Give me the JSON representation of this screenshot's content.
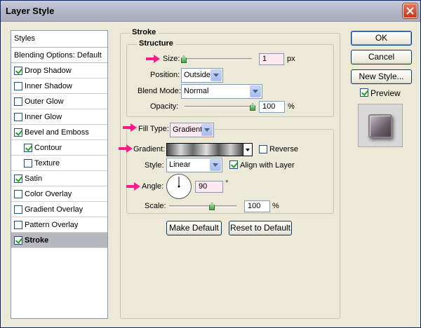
{
  "window": {
    "title": "Layer Style"
  },
  "styles_list": {
    "header": "Styles",
    "items": [
      {
        "label": "Blending Options: Default",
        "checkbox": false,
        "checked": false,
        "indent": false,
        "selected": false
      },
      {
        "label": "Drop Shadow",
        "checkbox": true,
        "checked": true,
        "indent": false,
        "selected": false
      },
      {
        "label": "Inner Shadow",
        "checkbox": true,
        "checked": false,
        "indent": false,
        "selected": false
      },
      {
        "label": "Outer Glow",
        "checkbox": true,
        "checked": false,
        "indent": false,
        "selected": false
      },
      {
        "label": "Inner Glow",
        "checkbox": true,
        "checked": false,
        "indent": false,
        "selected": false
      },
      {
        "label": "Bevel and Emboss",
        "checkbox": true,
        "checked": true,
        "indent": false,
        "selected": false
      },
      {
        "label": "Contour",
        "checkbox": true,
        "checked": true,
        "indent": true,
        "selected": false
      },
      {
        "label": "Texture",
        "checkbox": true,
        "checked": false,
        "indent": true,
        "selected": false
      },
      {
        "label": "Satin",
        "checkbox": true,
        "checked": true,
        "indent": false,
        "selected": false
      },
      {
        "label": "Color Overlay",
        "checkbox": true,
        "checked": false,
        "indent": false,
        "selected": false
      },
      {
        "label": "Gradient Overlay",
        "checkbox": true,
        "checked": false,
        "indent": false,
        "selected": false
      },
      {
        "label": "Pattern Overlay",
        "checkbox": true,
        "checked": false,
        "indent": false,
        "selected": false
      },
      {
        "label": "Stroke",
        "checkbox": true,
        "checked": true,
        "indent": false,
        "selected": true
      }
    ]
  },
  "stroke": {
    "group_title": "Stroke",
    "structure_title": "Structure",
    "size_label": "Size:",
    "size_value": "1",
    "size_unit": "px",
    "position_label": "Position:",
    "position_value": "Outside",
    "blend_mode_label": "Blend Mode:",
    "blend_mode_value": "Normal",
    "opacity_label": "Opacity:",
    "opacity_value": "100",
    "opacity_unit": "%",
    "fill_type_label": "Fill Type:",
    "fill_type_value": "Gradient",
    "gradient_label": "Gradient:",
    "reverse_label": "Reverse",
    "reverse_checked": false,
    "style_label": "Style:",
    "style_value": "Linear",
    "align_label": "Align with Layer",
    "align_checked": true,
    "angle_label": "Angle:",
    "angle_value": "90",
    "angle_unit": "°",
    "scale_label": "Scale:",
    "scale_value": "100",
    "scale_unit": "%",
    "make_default_label": "Make Default",
    "reset_default_label": "Reset to Default"
  },
  "actions": {
    "ok_label": "OK",
    "cancel_label": "Cancel",
    "new_style_label": "New Style...",
    "preview_label": "Preview",
    "preview_checked": true
  },
  "icons": {
    "close": "close-icon",
    "annotation_arrow": "pink-arrow-icon",
    "angle_dial": "angle-dial-icon"
  },
  "colors": {
    "title_bar": "#b4b8c8",
    "selected_item": "#b8b8c0",
    "annotation_arrow": "#ff1a8c",
    "input_highlight": "#fde9ef"
  }
}
